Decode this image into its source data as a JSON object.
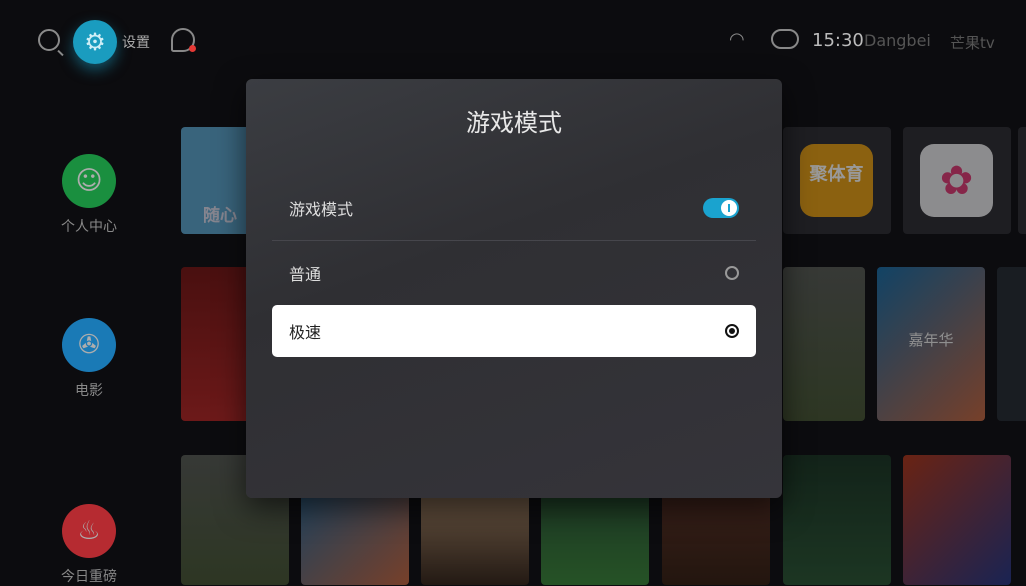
{
  "topbar": {
    "settings_label": "设置",
    "time": "15:30",
    "brand": "Dangbei",
    "brand2": "芒果tv"
  },
  "sidebar": {
    "items": [
      {
        "label": "个人中心",
        "icon": "person-icon",
        "color": "#1ea84a"
      },
      {
        "label": "电影",
        "icon": "film-reel-icon",
        "color": "#1f8fd6"
      },
      {
        "label": "今日重磅",
        "icon": "flame-icon",
        "color": "#d6333a"
      }
    ]
  },
  "tiles": {
    "row1": [
      {
        "label": "随心",
        "color": "#5fa6cf"
      },
      {
        "label": "聚体育",
        "color": "#e8a21a"
      },
      {
        "label": "",
        "color": "#e9e9ec"
      }
    ],
    "poster_title": "嘉年华"
  },
  "dialog": {
    "title": "游戏模式",
    "toggle_label": "游戏模式",
    "toggle_on": true,
    "options": [
      {
        "label": "普通",
        "selected": false
      },
      {
        "label": "极速",
        "selected": true
      }
    ]
  }
}
